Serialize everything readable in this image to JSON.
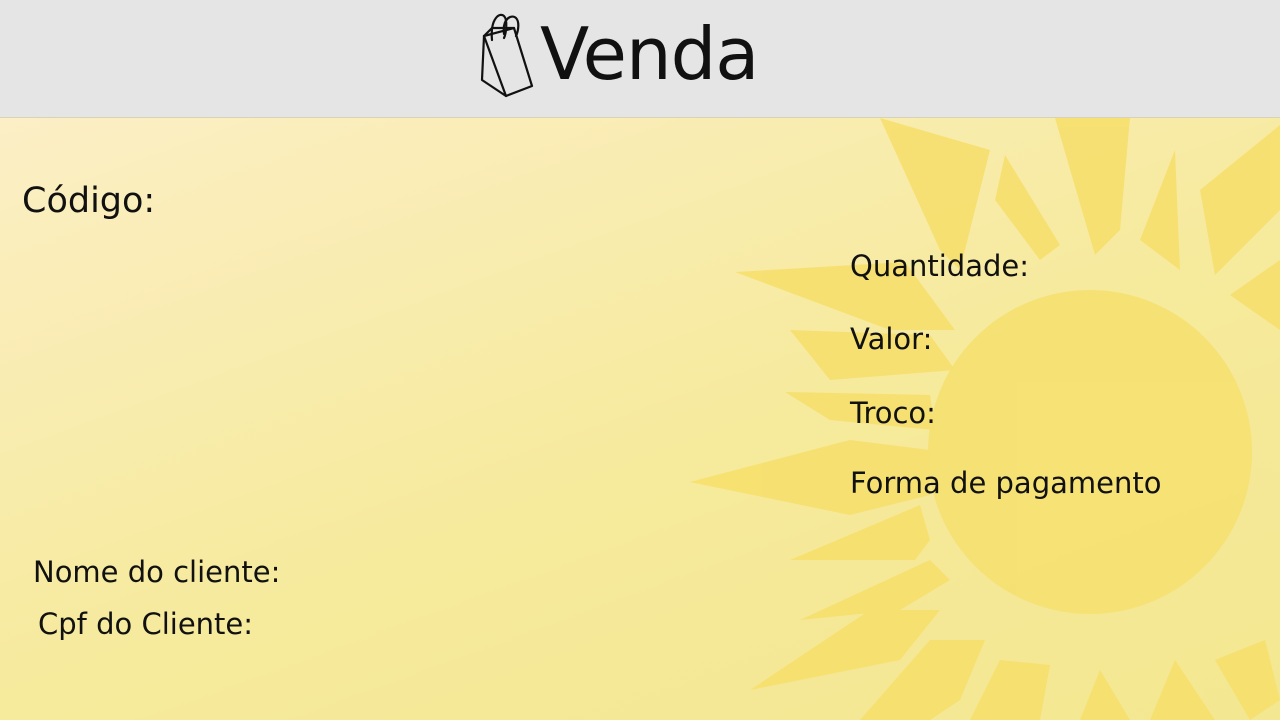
{
  "header": {
    "title": "Venda",
    "icon": "shopping-bag-icon",
    "background": "#e5e5e5"
  },
  "form": {
    "codigo_label": "Código:",
    "quantidade_label": "Quantidade:",
    "valor_label": "Valor:",
    "troco_label": "Troco:",
    "forma_pagamento_label": "Forma de pagamento",
    "nome_cliente_label": "Nome do cliente:",
    "cpf_cliente_label": "Cpf do Cliente:"
  },
  "theme": {
    "background_colors": [
      "#fdf0cf",
      "#f6ea9c"
    ],
    "sun_color": "#f7df6a"
  }
}
